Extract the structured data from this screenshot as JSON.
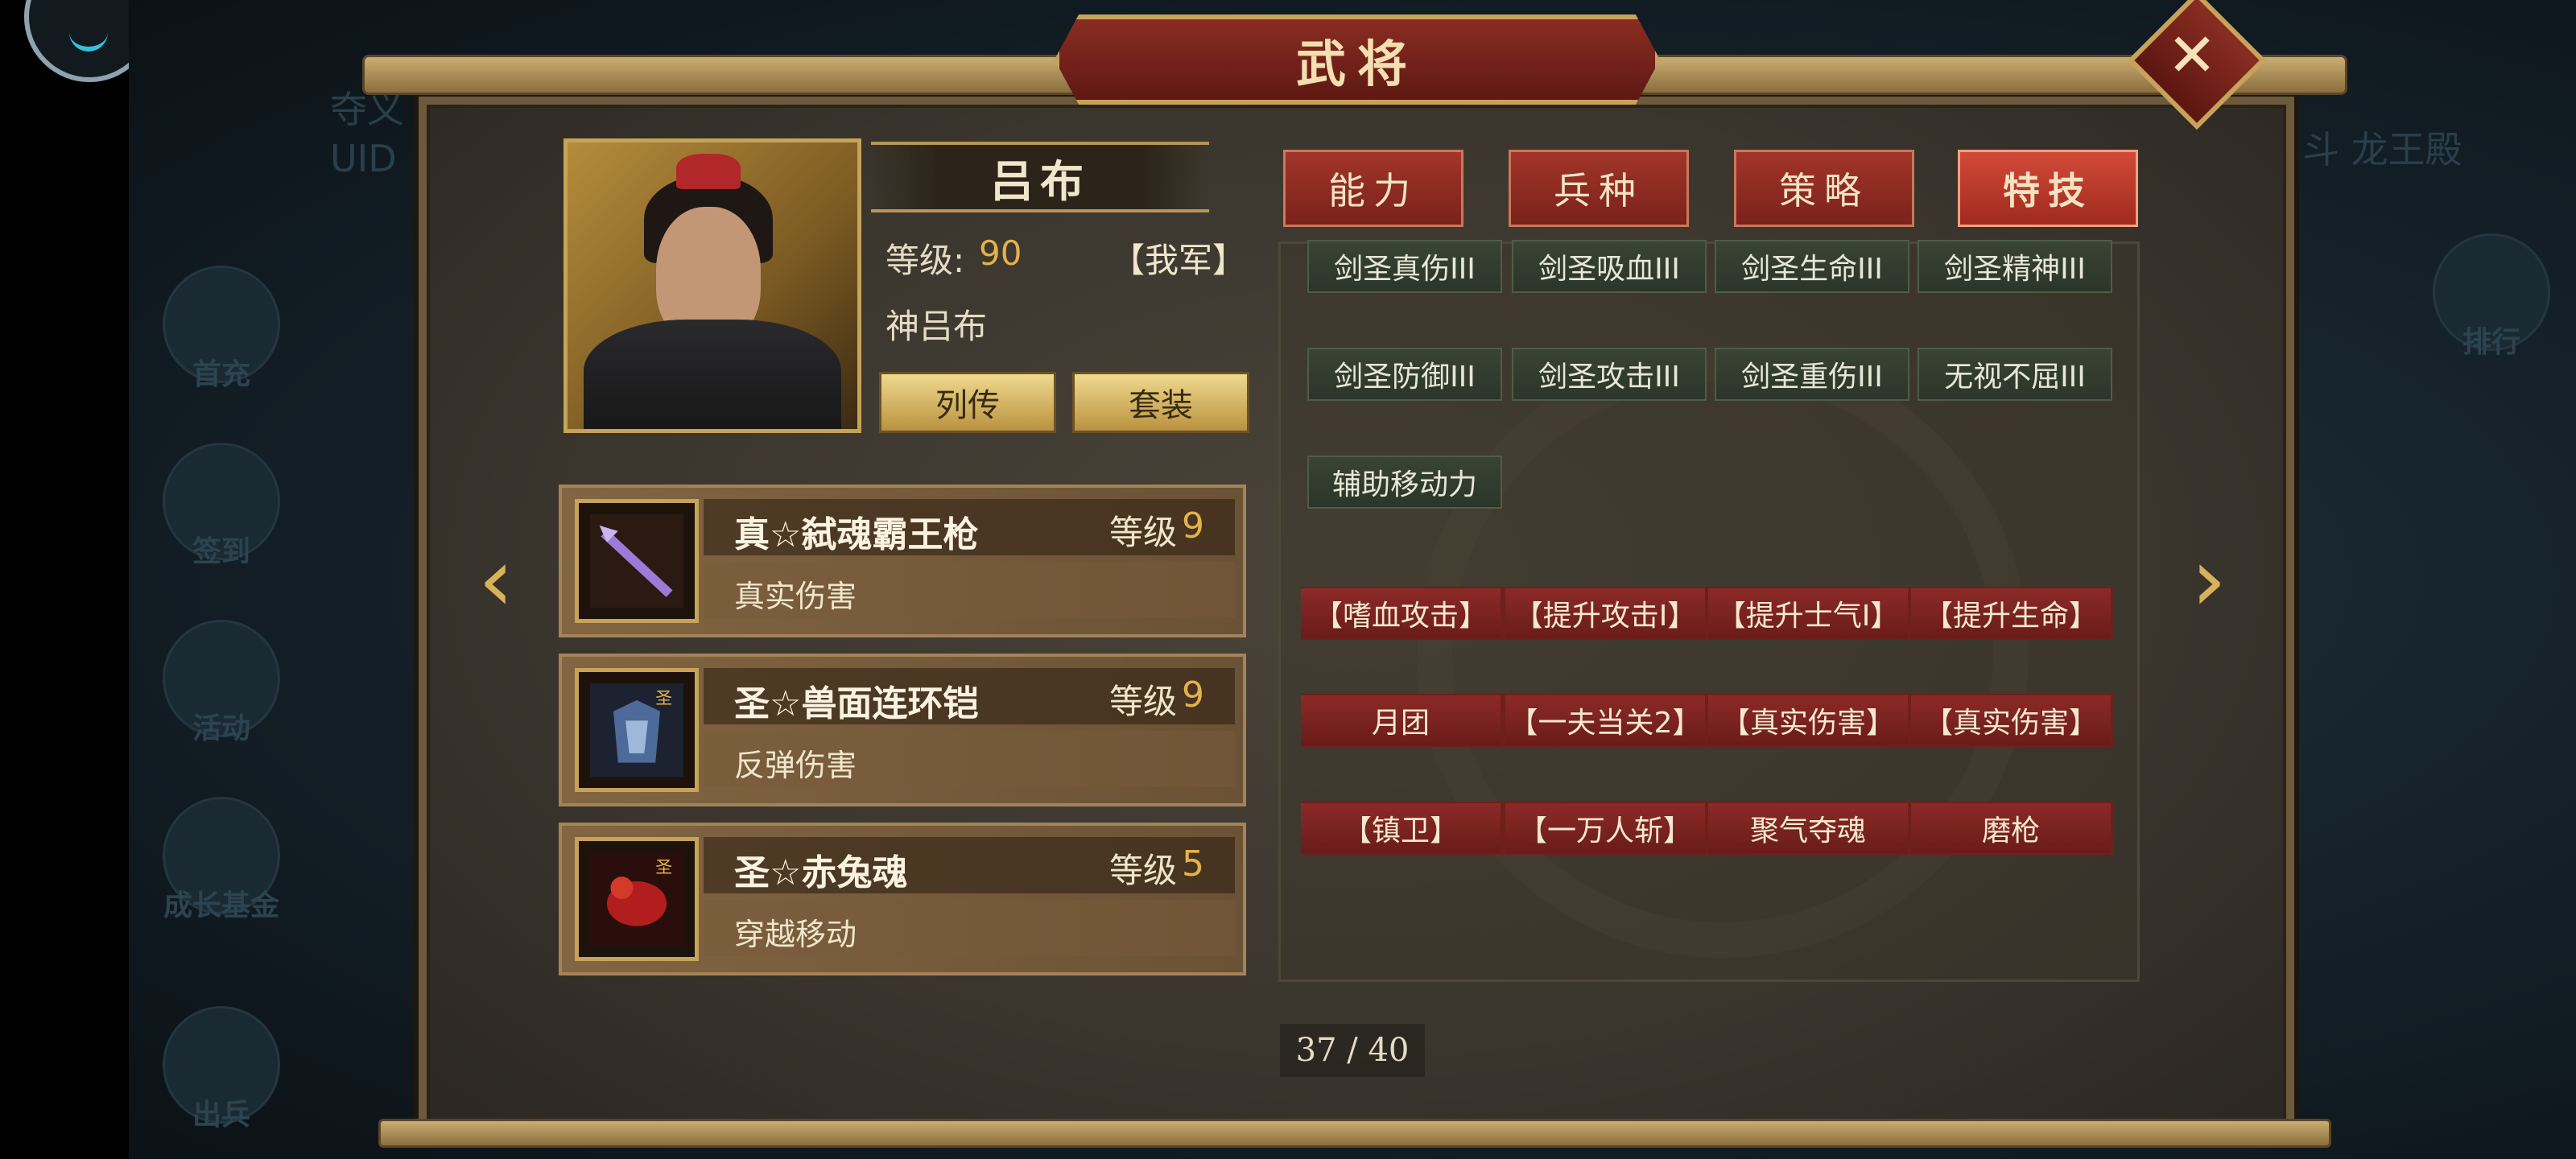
{
  "window": {
    "title": "武将"
  },
  "background": {
    "menu": [
      "首充",
      "签到",
      "活动",
      "成长基金",
      "出兵"
    ],
    "right_menu": [
      "排行"
    ],
    "uid_label": "UID",
    "top_text": "斗 龙王殿",
    "partial_label": "夺义"
  },
  "general": {
    "name": "吕布",
    "level_label": "等级:",
    "level_value": "90",
    "faction": "【我军】",
    "title": "神吕布",
    "biography_button": "列传",
    "set_button": "套装"
  },
  "equipment": [
    {
      "name": "真☆弑魂霸王枪",
      "level_label": "等级",
      "level": "9",
      "effect": "真实伤害",
      "icon": "spear-icon"
    },
    {
      "name": "圣☆兽面连环铠",
      "level_label": "等级",
      "level": "9",
      "effect": "反弹伤害",
      "icon": "armor-icon"
    },
    {
      "name": "圣☆赤兔魂",
      "level_label": "等级",
      "level": "5",
      "effect": "穿越移动",
      "icon": "horse-icon"
    }
  ],
  "tabs": [
    {
      "label": "能力",
      "active": false
    },
    {
      "label": "兵种",
      "active": false
    },
    {
      "label": "策略",
      "active": false
    },
    {
      "label": "特技",
      "active": true
    }
  ],
  "skills": [
    "剑圣真伤III",
    "剑圣吸血III",
    "剑圣生命III",
    "剑圣精神III",
    "剑圣防御III",
    "剑圣攻击III",
    "剑圣重伤III",
    "无视不屈III",
    "辅助移动力"
  ],
  "perks": [
    "【嗜血攻击】",
    "【提升攻击Ⅰ】",
    "【提升士气Ⅰ】",
    "【提升生命】",
    "月团",
    "【一夫当关2】",
    "【真实伤害】",
    "【真实伤害】",
    "【镇卫】",
    "【一万人斩】",
    "聚气夺魂",
    "磨枪"
  ],
  "pagination": {
    "text": "37 / 40"
  },
  "nav": {
    "prev_icon": "chevron-left-icon",
    "next_icon": "chevron-right-icon",
    "close_icon": "close-icon"
  },
  "colors": {
    "accent_gold": "#e3b24a",
    "tab_red": "#a2352a",
    "skill_green": "#394434",
    "perk_red": "#8b2a27"
  }
}
